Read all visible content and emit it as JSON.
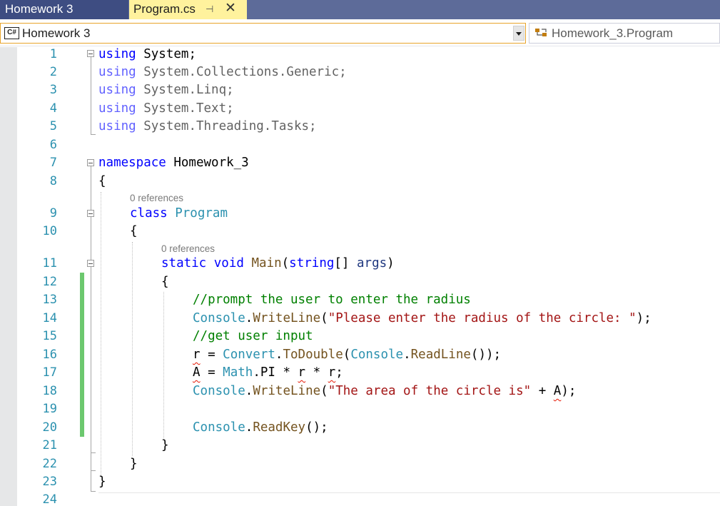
{
  "tabs": {
    "inactive_label": "Homework 3",
    "active_label": "Program.cs",
    "pin_glyph": "⊣",
    "close_glyph": "✕"
  },
  "navbar": {
    "project_badge": "C#",
    "project_name": "Homework 3",
    "class_name": "Homework_3.Program"
  },
  "codelens": {
    "class_refs": "0 references",
    "method_refs": "0 references"
  },
  "line_numbers": [
    "1",
    "2",
    "3",
    "4",
    "5",
    "6",
    "7",
    "8",
    "9",
    "10",
    "11",
    "12",
    "13",
    "14",
    "15",
    "16",
    "17",
    "18",
    "19",
    "20",
    "21",
    "22",
    "23",
    "24"
  ],
  "code": {
    "l1": {
      "kw": "using",
      "rest": " System;"
    },
    "l2": {
      "kw": "using",
      "rest": " System.Collections.Generic;"
    },
    "l3": {
      "kw": "using",
      "rest": " System.Linq;"
    },
    "l4": {
      "kw": "using",
      "rest": " System.Text;"
    },
    "l5": {
      "kw": "using",
      "rest": " System.Threading.Tasks;"
    },
    "l7": {
      "kw": "namespace",
      "name": " Homework_3"
    },
    "l8": "{",
    "l9": {
      "kw": "class",
      "name": "Program"
    },
    "l10": "{",
    "l11": {
      "kw1": "static",
      "kw2": "void",
      "method": "Main",
      "open": "(",
      "kw3": "string",
      "mid": "[] ",
      "param": "args",
      "close": ")"
    },
    "l12": "{",
    "l13": "//prompt the user to enter the radius",
    "l14": {
      "t1": "Console",
      "dot": ".",
      "m": "WriteLine",
      "open": "(",
      "s": "\"Please enter the radius of the circle: \"",
      "close": ");"
    },
    "l15": "//get user input",
    "l16": {
      "v": "r",
      "eq": " = ",
      "t1": "Convert",
      "m1": "ToDouble",
      "t2": "Console",
      "m2": "ReadLine",
      "tail": "());"
    },
    "l17": {
      "v": "A",
      "eq": " = ",
      "t1": "Math",
      "prop": ".PI * ",
      "r1": "r",
      "op": " * ",
      "r2": "r",
      "tail": ";"
    },
    "l18": {
      "t1": "Console",
      "m": "WriteLine",
      "s": "\"The area of the circle is\"",
      "plus": " + ",
      "v": "A",
      "tail": ");"
    },
    "l20": {
      "t1": "Console",
      "m": "ReadKey",
      "tail": "();"
    },
    "l21": "}",
    "l22": "}",
    "l23": "}"
  },
  "colors": {
    "keyword": "#0000ff",
    "type": "#2b91af",
    "method": "#74531f",
    "string": "#a31515",
    "comment": "#008000",
    "change_bar": "#6cc86e",
    "active_tab": "#fff29d"
  },
  "icons": {
    "pin": "pin-icon",
    "close": "close-icon",
    "dropdown": "chevron-down-icon",
    "class": "class-icon",
    "csharp": "csharp-project-icon"
  }
}
